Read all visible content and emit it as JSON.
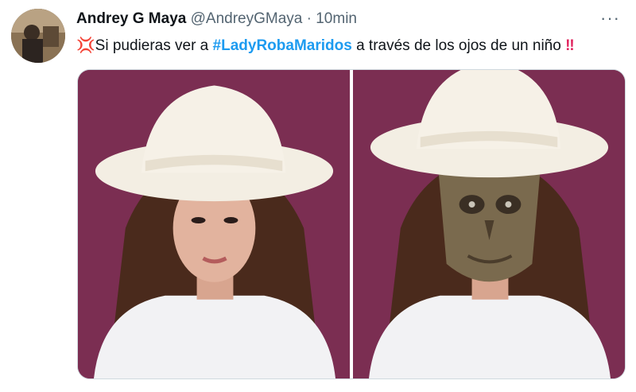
{
  "tweet": {
    "author_name": "Andrey G Maya",
    "handle": "@AndreyGMaya",
    "separator": "·",
    "time": "10min",
    "more_label": "···",
    "text_before": "Si pudieras ver a ",
    "hashtag": "#LadyRobaMaridos",
    "text_after": " a través de los ojos de un niño",
    "emoji_anger": "💢",
    "emoji_bang": "‼"
  },
  "colors": {
    "hashtag": "#1d9bf0",
    "muted": "#536471",
    "background_photo": "#7b2e52"
  },
  "icons": [
    "more-options-icon",
    "anger-emoji-icon",
    "double-exclamation-icon"
  ]
}
